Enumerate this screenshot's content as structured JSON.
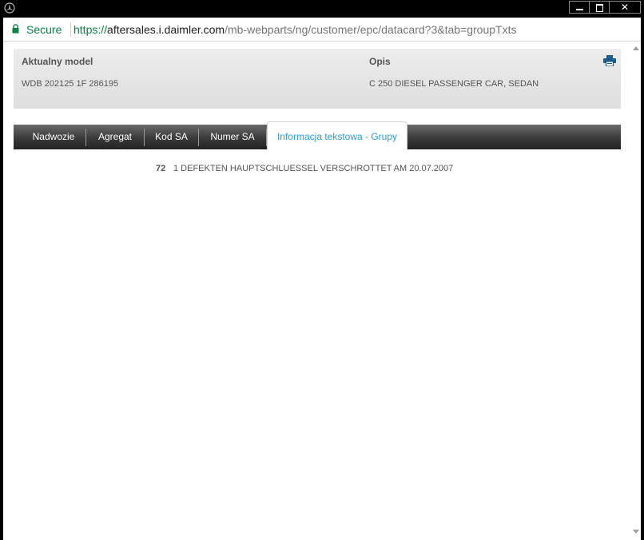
{
  "browser": {
    "secure_label": "Secure",
    "url": {
      "scheme": "https://",
      "host": "aftersales.i.daimler.com",
      "path": "/mb-webparts/ng/customer/epc/datacard?3&tab=groupTxts"
    },
    "window_buttons": {
      "close": "✕"
    }
  },
  "info": {
    "model_label": "Aktualny model",
    "model_value": "WDB 202125 1F 286195",
    "description_label": "Opis",
    "description_value": "C 250 DIESEL PASSENGER CAR, SEDAN"
  },
  "tabs": [
    {
      "label": "Nadwozie"
    },
    {
      "label": "Agregat"
    },
    {
      "label": "Kod SA"
    },
    {
      "label": "Numer SA"
    },
    {
      "label": "Informacja tekstowa - Grupy"
    }
  ],
  "group_texts": [
    {
      "number": "72",
      "text": "1 DEFEKTEN HAUPTSCHLUESSEL VERSCHROTTET AM 20.07.2007"
    }
  ],
  "colors": {
    "accent": "#2a9fd8",
    "secure_green": "#0b8043",
    "print_icon": "#1c5d8c"
  },
  "icons": [
    "mercedes-logo-icon",
    "lock-icon",
    "print-icon",
    "minimize-icon",
    "maximize-icon",
    "close-icon"
  ]
}
